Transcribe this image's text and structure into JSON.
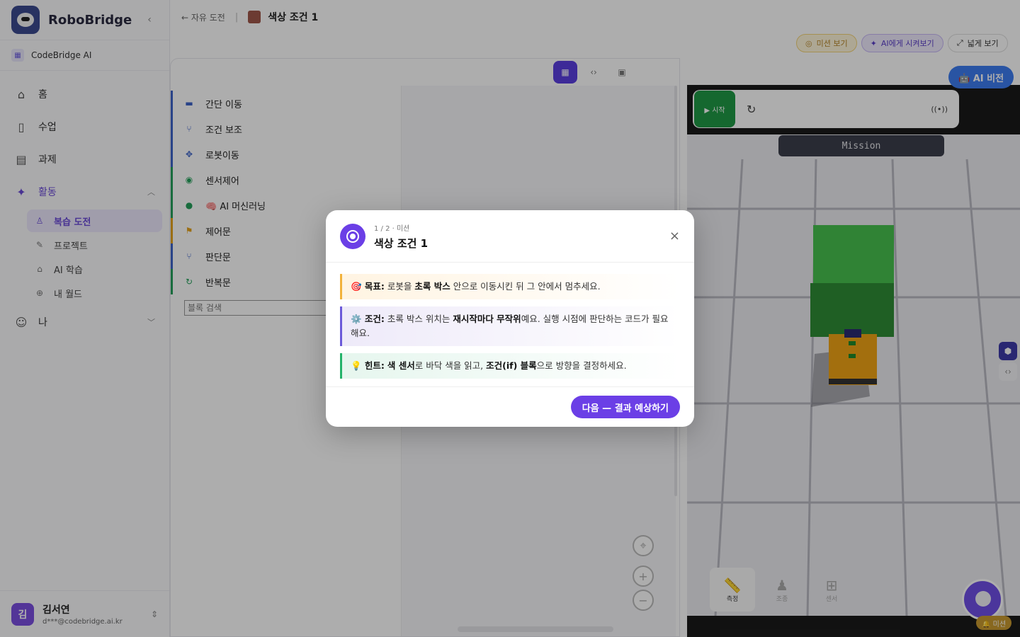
{
  "brand": {
    "name": "RoboBridge"
  },
  "org": {
    "name": "CodeBridge AI"
  },
  "nav": {
    "home": "홈",
    "classes": "수업",
    "assignments": "과제",
    "activities": "활동",
    "sub": {
      "review": "복습 도전",
      "project": "프로젝트",
      "ai_learning": "AI 학습",
      "my_world": "내 월드"
    },
    "me": "나"
  },
  "user": {
    "name": "김서연",
    "email": "d***@codebridge.ai.kr",
    "initial": "김"
  },
  "topbar": {
    "back": "← 자유 도전",
    "separator": "|",
    "title": "색상 조건 1"
  },
  "actions": {
    "mission": "미션 보기",
    "ai": "AI에게 시켜보기",
    "wide": "넓게 보기"
  },
  "categories": [
    {
      "label": "간단 이동",
      "icon": "car-icon",
      "color": "#3d63c9"
    },
    {
      "label": "조건 보조",
      "icon": "branch-icon",
      "color": "#3d63c9"
    },
    {
      "label": "로봇이동",
      "icon": "move-icon",
      "color": "#3d63c9"
    },
    {
      "label": "센서제어",
      "icon": "sensor-icon",
      "color": "#24a05a"
    },
    {
      "label": "🧠 AI 머신러닝",
      "icon": "ai-icon",
      "color": "#24a05a"
    },
    {
      "label": "제어문",
      "icon": "flag-icon",
      "color": "#e5a21c"
    },
    {
      "label": "판단문",
      "icon": "branch-icon",
      "color": "#3d63c9"
    },
    {
      "label": "반복문",
      "icon": "loop-icon",
      "color": "#24a05a"
    }
  ],
  "search": {
    "placeholder": "블록 검색"
  },
  "stage": {
    "start": "▶ 시작",
    "mission": "Mission",
    "ai_vision": "🤖 AI 비전",
    "tools": [
      "측정",
      "조종",
      "센서"
    ],
    "mascot_badge": "🔔 미션"
  },
  "modal": {
    "step": "1 / 2 · 미션",
    "title": "색상 조건 1",
    "goal": {
      "prefix": "🎯 목표:",
      "t1": " 로봇을 ",
      "b1": "초록 박스",
      "t2": " 안으로 이동시킨 뒤 그 안에서 멈추세요."
    },
    "cond": {
      "prefix": "⚙️ 조건:",
      "t1": " 초록 박스 위치는 ",
      "b1": "재시작마다 무작위",
      "t2": "예요. 실행 시점에 판단하는 코드가 필요해요."
    },
    "hint": {
      "prefix": "💡 힌트:",
      "t1": " ",
      "b1": "색 센서",
      "t2": "로 바닥 색을 읽고, ",
      "b2": "조건(if) 블록",
      "t3": "으로 방향을 결정하세요."
    },
    "next": "다음 — 결과 예상하기",
    "close": "×"
  },
  "colors": {
    "accent": "#6b3fe6",
    "ai_blue": "#3d7cf0",
    "start_green": "#1f9a46"
  }
}
